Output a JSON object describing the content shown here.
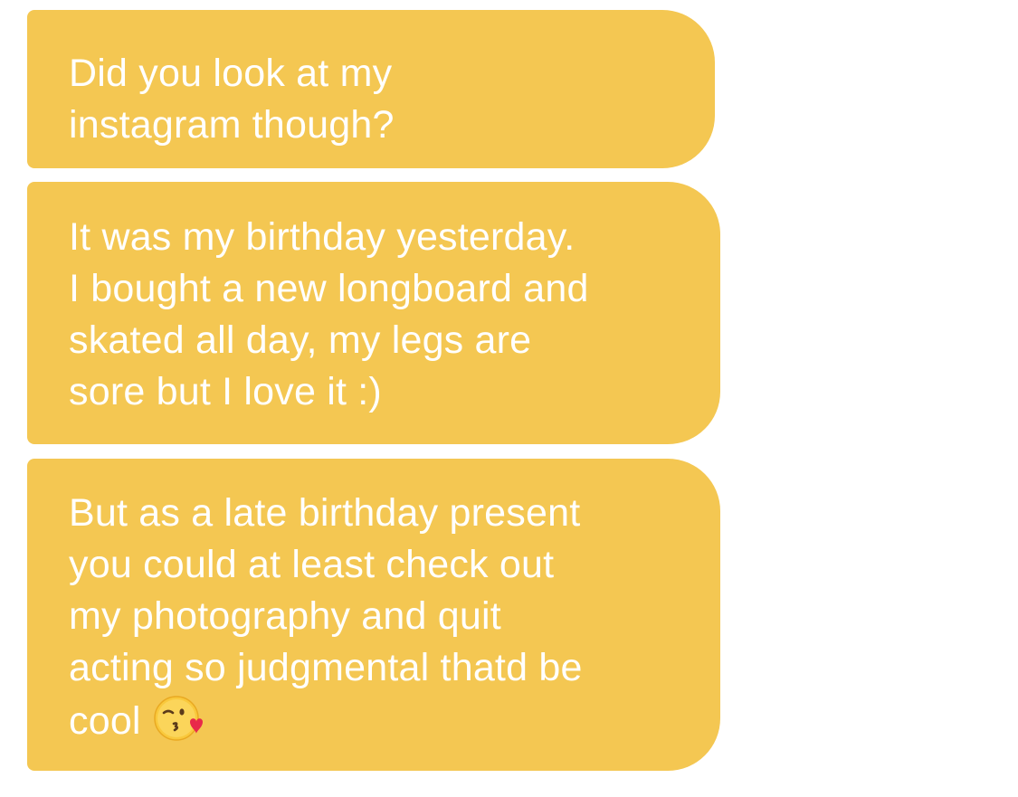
{
  "messages": [
    {
      "text": "Did you look at my\ninstagram though?"
    },
    {
      "text": "It was my birthday yesterday.\nI bought a new longboard and\nskated all day, my legs are\nsore but I love it :)"
    },
    {
      "text_before_emoji": "But as a late birthday present\nyou could at least check out\nmy photography and quit\nacting so judgmental thatd be\ncool",
      "emoji": "kissing-face-with-heart-icon"
    }
  ],
  "colors": {
    "bubble": "#f4c752",
    "text": "#ffffff",
    "background": "#ffffff"
  }
}
